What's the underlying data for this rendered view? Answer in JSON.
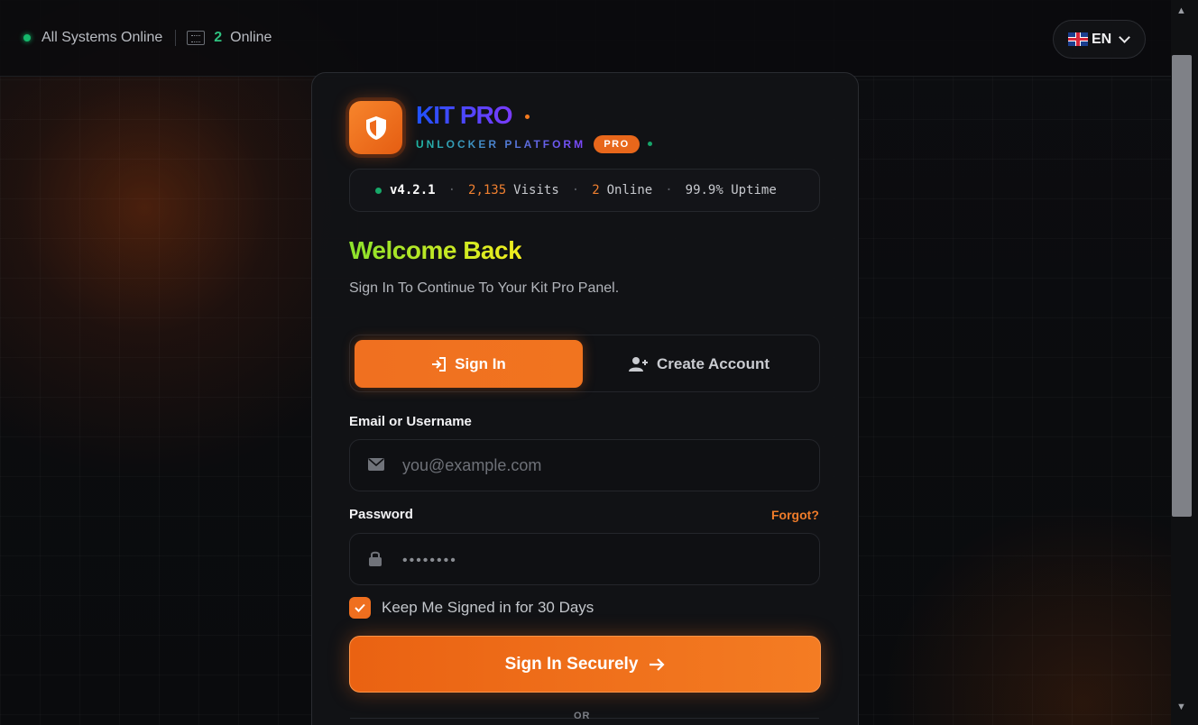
{
  "status": {
    "systems_text": "All Systems Online",
    "online_count": "2",
    "online_label": "Online"
  },
  "language": {
    "code": "EN"
  },
  "brand": {
    "name": "KIT PRO",
    "tagline": "UNLOCKER PLATFORM",
    "badge": "PRO"
  },
  "stats": {
    "version": "v4.2.1",
    "visits_count": "2,135",
    "visits_label": "Visits",
    "online_count": "2",
    "online_label": "Online",
    "uptime": "99.9% Uptime"
  },
  "welcome": {
    "title": "Welcome Back",
    "subtitle": "Sign In To Continue To Your Kit Pro Panel."
  },
  "tabs": {
    "sign_in": "Sign In",
    "create_account": "Create Account"
  },
  "form": {
    "email_label": "Email or Username",
    "email_placeholder": "you@example.com",
    "password_label": "Password",
    "password_placeholder": "••••••••",
    "forgot": "Forgot?",
    "remember_label": "Keep Me Signed in for 30 Days",
    "submit": "Sign In Securely"
  },
  "divider": {
    "text": "OR"
  },
  "colors": {
    "accent": "#f07020",
    "online": "#15b86b",
    "background": "#0a0b0d"
  }
}
